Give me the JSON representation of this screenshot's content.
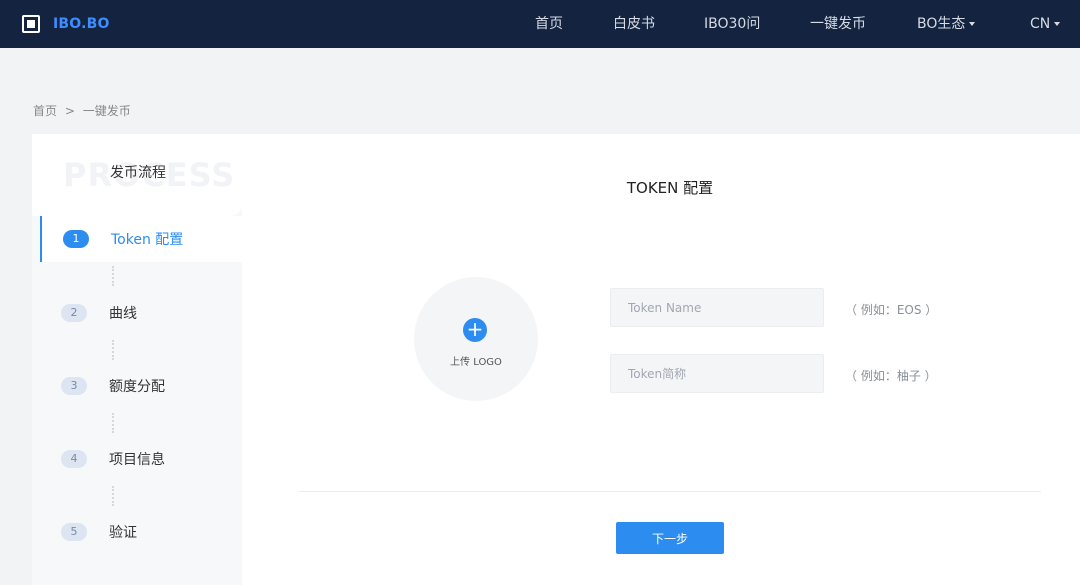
{
  "nav": {
    "logo": "IBO.BO",
    "items": [
      {
        "label": "首页",
        "dropdown": false
      },
      {
        "label": "白皮书",
        "dropdown": false
      },
      {
        "label": "IBO30问",
        "dropdown": false
      },
      {
        "label": "一键发币",
        "dropdown": false
      },
      {
        "label": "BO生态",
        "dropdown": true
      },
      {
        "label": "CN",
        "dropdown": true
      }
    ]
  },
  "breadcrumb": {
    "home": "首页",
    "separator": ">",
    "current": "一键发币"
  },
  "sidebar": {
    "watermark": "PROCESS",
    "title": "发币流程",
    "steps": [
      {
        "num": "1",
        "label": "Token 配置",
        "active": true
      },
      {
        "num": "2",
        "label": "曲线",
        "active": false
      },
      {
        "num": "3",
        "label": "额度分配",
        "active": false
      },
      {
        "num": "4",
        "label": "项目信息",
        "active": false
      },
      {
        "num": "5",
        "label": "验证",
        "active": false
      }
    ]
  },
  "form": {
    "title": "TOKEN 配置",
    "upload_label": "上传 LOGO",
    "plus_icon": "+",
    "name_placeholder": "Token Name",
    "name_hint": "（ 例如：EOS ）",
    "symbol_placeholder": "Token简称",
    "symbol_hint": "（ 例如：柚子 ）",
    "next_label": "下一步"
  },
  "colors": {
    "nav_bg": "#132340",
    "accent": "#2d8cf0",
    "logo_text": "#3d8dff"
  }
}
